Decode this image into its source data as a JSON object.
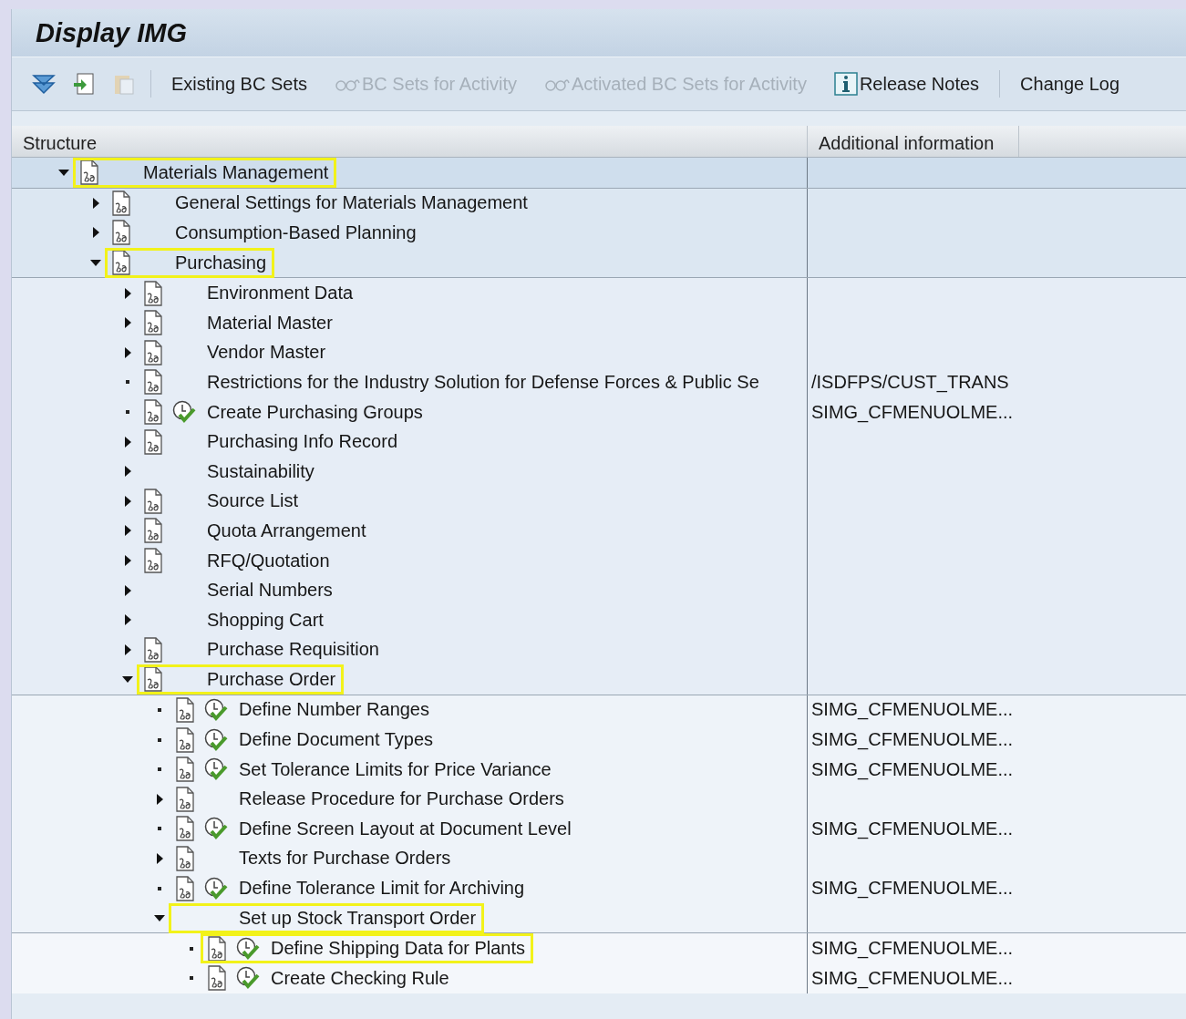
{
  "window": {
    "title": "Display IMG"
  },
  "toolbar": [
    {
      "kind": "expand",
      "disabled": false
    },
    {
      "kind": "insert",
      "disabled": false
    },
    {
      "kind": "clipboard",
      "disabled": true
    },
    {
      "kind": "separator"
    },
    {
      "kind": "text",
      "label": "Existing BC Sets",
      "disabled": false
    },
    {
      "kind": "bcset",
      "label": "BC Sets for Activity",
      "disabled": true
    },
    {
      "kind": "bcset",
      "label": "Activated BC Sets for Activity",
      "disabled": true
    },
    {
      "kind": "info",
      "label": "Release Notes",
      "disabled": false
    },
    {
      "kind": "separator"
    },
    {
      "kind": "text",
      "label": "Change Log",
      "disabled": false
    }
  ],
  "columns": [
    "Structure",
    "Additional information"
  ],
  "tree": [
    {
      "label": "Materials Management",
      "expanded": true,
      "doc": true,
      "activity": false,
      "highlighted": true,
      "children": [
        {
          "label": "General Settings for Materials Management",
          "expanded": false,
          "doc": true,
          "activity": false,
          "highlighted": false
        },
        {
          "label": "Consumption-Based Planning",
          "expanded": false,
          "doc": true,
          "activity": false,
          "highlighted": false
        },
        {
          "label": "Purchasing",
          "expanded": true,
          "doc": true,
          "activity": false,
          "highlighted": true,
          "children": [
            {
              "label": "Environment Data",
              "expanded": false,
              "doc": true,
              "activity": false,
              "highlighted": false
            },
            {
              "label": "Material Master",
              "expanded": false,
              "doc": true,
              "activity": false,
              "highlighted": false
            },
            {
              "label": "Vendor Master",
              "expanded": false,
              "doc": true,
              "activity": false,
              "highlighted": false
            },
            {
              "label": "Restrictions for the Industry Solution for Defense Forces & Public Se",
              "info": "/ISDFPS/CUST_TRANS",
              "doc": true,
              "activity": false,
              "highlighted": false
            },
            {
              "label": "Create Purchasing Groups",
              "info": "SIMG_CFMENUOLME...",
              "doc": true,
              "activity": true,
              "highlighted": false
            },
            {
              "label": "Purchasing Info Record",
              "expanded": false,
              "doc": true,
              "activity": false,
              "highlighted": false
            },
            {
              "label": "Sustainability",
              "expanded": false,
              "doc": false,
              "activity": false,
              "highlighted": false
            },
            {
              "label": "Source List",
              "expanded": false,
              "doc": true,
              "activity": false,
              "highlighted": false
            },
            {
              "label": "Quota Arrangement",
              "expanded": false,
              "doc": true,
              "activity": false,
              "highlighted": false
            },
            {
              "label": "RFQ/Quotation",
              "expanded": false,
              "doc": true,
              "activity": false,
              "highlighted": false
            },
            {
              "label": "Serial Numbers",
              "expanded": false,
              "doc": false,
              "activity": false,
              "highlighted": false
            },
            {
              "label": "Shopping Cart",
              "expanded": false,
              "doc": false,
              "activity": false,
              "highlighted": false
            },
            {
              "label": "Purchase Requisition",
              "expanded": false,
              "doc": true,
              "activity": false,
              "highlighted": false
            },
            {
              "label": "Purchase Order",
              "expanded": true,
              "doc": true,
              "activity": false,
              "highlighted": true,
              "children": [
                {
                  "label": "Define Number Ranges",
                  "info": "SIMG_CFMENUOLME...",
                  "doc": true,
                  "activity": true,
                  "highlighted": false
                },
                {
                  "label": "Define Document Types",
                  "info": "SIMG_CFMENUOLME...",
                  "doc": true,
                  "activity": true,
                  "highlighted": false
                },
                {
                  "label": "Set Tolerance Limits for Price Variance",
                  "info": "SIMG_CFMENUOLME...",
                  "doc": true,
                  "activity": true,
                  "highlighted": false
                },
                {
                  "label": "Release Procedure for Purchase Orders",
                  "expanded": false,
                  "doc": true,
                  "activity": false,
                  "highlighted": false
                },
                {
                  "label": "Define Screen Layout at Document Level",
                  "info": "SIMG_CFMENUOLME...",
                  "doc": true,
                  "activity": true,
                  "highlighted": false
                },
                {
                  "label": "Texts for Purchase Orders",
                  "expanded": false,
                  "doc": true,
                  "activity": false,
                  "highlighted": false
                },
                {
                  "label": "Define Tolerance Limit for Archiving",
                  "info": "SIMG_CFMENUOLME...",
                  "doc": true,
                  "activity": true,
                  "highlighted": false
                },
                {
                  "label": "Set up Stock Transport Order",
                  "expanded": true,
                  "doc": false,
                  "activity": false,
                  "highlighted": true,
                  "children": [
                    {
                      "label": "Define Shipping Data for Plants",
                      "info": "SIMG_CFMENUOLME...",
                      "doc": true,
                      "activity": true,
                      "highlighted": true
                    },
                    {
                      "label": "Create Checking Rule",
                      "info": "SIMG_CFMENUOLME...",
                      "doc": true,
                      "activity": true,
                      "highlighted": false
                    }
                  ]
                }
              ]
            }
          ]
        }
      ]
    }
  ]
}
